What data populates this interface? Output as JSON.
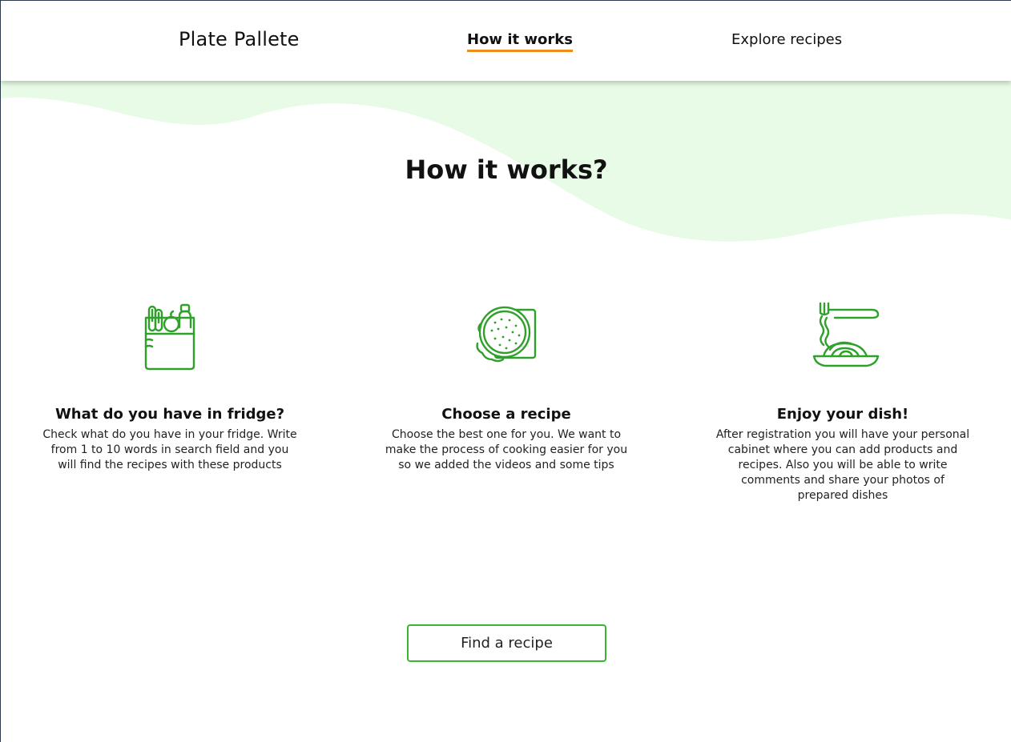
{
  "header": {
    "brand": "Plate Pallete",
    "nav": [
      {
        "label": "How it works",
        "active": true
      },
      {
        "label": "Explore recipes",
        "active": false
      }
    ]
  },
  "section": {
    "title": "How it works?",
    "steps": [
      {
        "icon": "grocery-bag-icon",
        "title": "What do you have in fridge?",
        "text": "Check what do you have in your fridge. Write from 1 to 10 words in search field and you will find the recipes with these products"
      },
      {
        "icon": "burger-recipe-icon",
        "title": "Choose a recipe",
        "text": "Choose the best one for you. We want to make the process of cooking easier for you so we added the videos and some tips"
      },
      {
        "icon": "spaghetti-fork-icon",
        "title": "Enjoy your dish!",
        "text": "After registration you will have your personal cabinet where you can add products and recipes. Also you will be able to write comments and share your photos of prepared dishes"
      }
    ],
    "cta_label": "Find a recipe"
  },
  "colors": {
    "accent_green": "#39b52f",
    "icon_green": "#2fa12a",
    "wave_green": "#e8fbe6",
    "active_underline": "#ef8c1a"
  }
}
